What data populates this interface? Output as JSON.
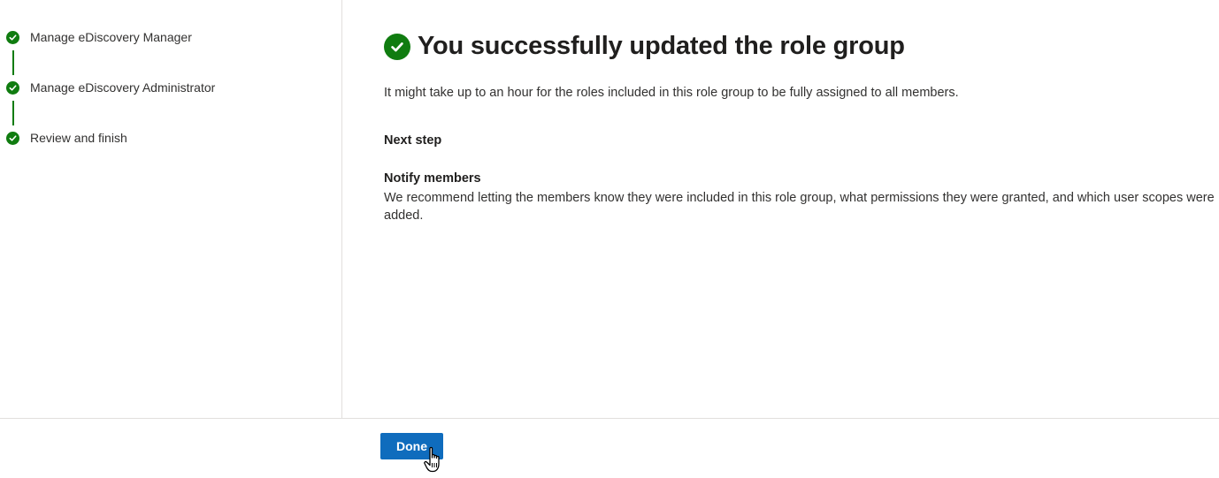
{
  "steps": [
    {
      "label": "Manage eDiscovery Manager",
      "status": "complete"
    },
    {
      "label": "Manage eDiscovery Administrator",
      "status": "complete"
    },
    {
      "label": "Review and finish",
      "status": "complete"
    }
  ],
  "main": {
    "title": "You successfully updated the role group",
    "description": "It might take up to an hour for the roles included in this role group to be fully assigned to all members.",
    "next_step_heading": "Next step",
    "notify_title": "Notify members",
    "notify_body": "We recommend letting the members know they were included in this role group, what permissions they were granted, and which user scopes were added."
  },
  "footer": {
    "done_label": "Done"
  },
  "icons": {
    "step_icon": "checkmark-circle-icon",
    "title_icon": "checkmark-circle-icon",
    "cursor": "hand-pointer-cursor-icon"
  },
  "colors": {
    "success_green": "#107c10",
    "primary_blue": "#0f6cbd",
    "divider": "#e1dfdd"
  }
}
